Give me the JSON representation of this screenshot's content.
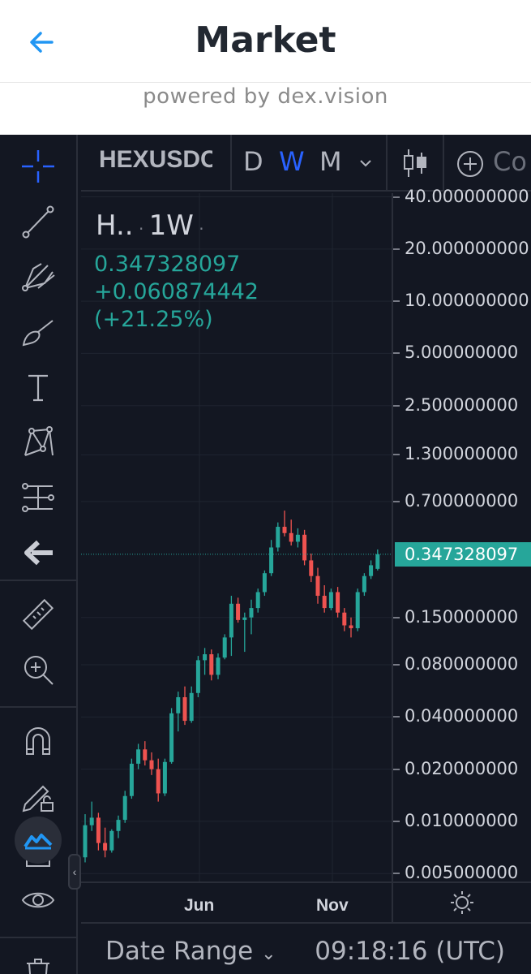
{
  "header": {
    "title": "Market",
    "subtitle": "powered by dex.vision"
  },
  "colors": {
    "up": "#26a69a",
    "down": "#ef5350",
    "background": "#131722",
    "accent": "#2962ff",
    "back_arrow": "#2196f3"
  },
  "toolbar_left": [
    "crosshair-icon",
    "trend-line-icon",
    "pitchfork-icon",
    "brush-icon",
    "text-icon",
    "pattern-icon",
    "prediction-icon",
    "back-arrow-icon",
    "ruler-icon",
    "zoom-in-icon",
    "magnet-icon",
    "lock-drawing-icon",
    "unlock-icon",
    "eye-icon",
    "trash-icon"
  ],
  "topbar": {
    "symbol": "HEXUSDC",
    "intervals": [
      "D",
      "W",
      "M"
    ],
    "active_interval": "W",
    "compare_label": "Co"
  },
  "legend": {
    "symbol": "H..",
    "interval": "1W",
    "price": "0.347328097",
    "change": "+0.060874442",
    "change_pct": "(+21.25%)"
  },
  "price_axis": {
    "ticks": [
      "40.000000000",
      "20.000000000",
      "10.000000000",
      "5.000000000",
      "2.500000000",
      "1.300000000",
      "0.700000000",
      "0.150000000",
      "0.080000000",
      "0.040000000",
      "0.020000000",
      "0.010000000",
      "0.005000000"
    ],
    "current": "0.347328097"
  },
  "time_axis": {
    "labels": [
      "Jun",
      "Nov"
    ]
  },
  "bottom": {
    "date_range": "Date Range",
    "clock": "09:18:16 (UTC)"
  },
  "chart_data": {
    "type": "candlestick",
    "scale": "log",
    "interval": "1W",
    "ylim": [
      0.0045,
      42
    ],
    "candles": [
      {
        "o": 0.0062,
        "h": 0.011,
        "l": 0.0058,
        "c": 0.0095
      },
      {
        "o": 0.0095,
        "h": 0.013,
        "l": 0.0088,
        "c": 0.0105
      },
      {
        "o": 0.0105,
        "h": 0.0112,
        "l": 0.0068,
        "c": 0.0075
      },
      {
        "o": 0.0075,
        "h": 0.0092,
        "l": 0.0062,
        "c": 0.0068
      },
      {
        "o": 0.0068,
        "h": 0.009,
        "l": 0.0066,
        "c": 0.0088
      },
      {
        "o": 0.0088,
        "h": 0.0108,
        "l": 0.008,
        "c": 0.0102
      },
      {
        "o": 0.0102,
        "h": 0.015,
        "l": 0.0098,
        "c": 0.014
      },
      {
        "o": 0.014,
        "h": 0.023,
        "l": 0.0135,
        "c": 0.0215
      },
      {
        "o": 0.0215,
        "h": 0.028,
        "l": 0.02,
        "c": 0.026
      },
      {
        "o": 0.026,
        "h": 0.029,
        "l": 0.021,
        "c": 0.0225
      },
      {
        "o": 0.0225,
        "h": 0.025,
        "l": 0.0185,
        "c": 0.02
      },
      {
        "o": 0.02,
        "h": 0.023,
        "l": 0.013,
        "c": 0.0145
      },
      {
        "o": 0.0145,
        "h": 0.023,
        "l": 0.014,
        "c": 0.022
      },
      {
        "o": 0.022,
        "h": 0.045,
        "l": 0.0215,
        "c": 0.042
      },
      {
        "o": 0.042,
        "h": 0.056,
        "l": 0.033,
        "c": 0.052
      },
      {
        "o": 0.052,
        "h": 0.06,
        "l": 0.036,
        "c": 0.038
      },
      {
        "o": 0.038,
        "h": 0.06,
        "l": 0.037,
        "c": 0.055
      },
      {
        "o": 0.055,
        "h": 0.09,
        "l": 0.052,
        "c": 0.085
      },
      {
        "o": 0.085,
        "h": 0.1,
        "l": 0.07,
        "c": 0.092
      },
      {
        "o": 0.092,
        "h": 0.098,
        "l": 0.065,
        "c": 0.07
      },
      {
        "o": 0.07,
        "h": 0.093,
        "l": 0.066,
        "c": 0.088
      },
      {
        "o": 0.088,
        "h": 0.12,
        "l": 0.086,
        "c": 0.115
      },
      {
        "o": 0.115,
        "h": 0.2,
        "l": 0.09,
        "c": 0.18
      },
      {
        "o": 0.18,
        "h": 0.195,
        "l": 0.14,
        "c": 0.145
      },
      {
        "o": 0.145,
        "h": 0.16,
        "l": 0.095,
        "c": 0.15
      },
      {
        "o": 0.15,
        "h": 0.19,
        "l": 0.12,
        "c": 0.17
      },
      {
        "o": 0.17,
        "h": 0.22,
        "l": 0.16,
        "c": 0.21
      },
      {
        "o": 0.21,
        "h": 0.28,
        "l": 0.2,
        "c": 0.27
      },
      {
        "o": 0.27,
        "h": 0.42,
        "l": 0.26,
        "c": 0.38
      },
      {
        "o": 0.38,
        "h": 0.53,
        "l": 0.36,
        "c": 0.5
      },
      {
        "o": 0.5,
        "h": 0.62,
        "l": 0.44,
        "c": 0.46
      },
      {
        "o": 0.46,
        "h": 0.55,
        "l": 0.39,
        "c": 0.41
      },
      {
        "o": 0.41,
        "h": 0.49,
        "l": 0.38,
        "c": 0.45
      },
      {
        "o": 0.45,
        "h": 0.48,
        "l": 0.3,
        "c": 0.32
      },
      {
        "o": 0.32,
        "h": 0.35,
        "l": 0.24,
        "c": 0.26
      },
      {
        "o": 0.26,
        "h": 0.29,
        "l": 0.18,
        "c": 0.2
      },
      {
        "o": 0.2,
        "h": 0.23,
        "l": 0.16,
        "c": 0.17
      },
      {
        "o": 0.17,
        "h": 0.22,
        "l": 0.165,
        "c": 0.21
      },
      {
        "o": 0.21,
        "h": 0.225,
        "l": 0.15,
        "c": 0.16
      },
      {
        "o": 0.16,
        "h": 0.17,
        "l": 0.125,
        "c": 0.135
      },
      {
        "o": 0.135,
        "h": 0.15,
        "l": 0.115,
        "c": 0.13
      },
      {
        "o": 0.13,
        "h": 0.22,
        "l": 0.125,
        "c": 0.21
      },
      {
        "o": 0.21,
        "h": 0.27,
        "l": 0.2,
        "c": 0.26
      },
      {
        "o": 0.26,
        "h": 0.32,
        "l": 0.25,
        "c": 0.3
      },
      {
        "o": 0.286,
        "h": 0.37,
        "l": 0.28,
        "c": 0.3473
      }
    ]
  }
}
